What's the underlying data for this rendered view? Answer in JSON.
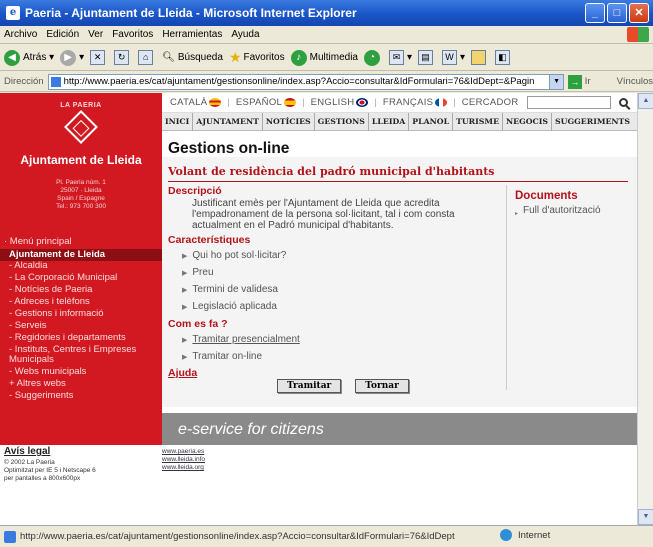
{
  "window": {
    "title": "Paeria - Ajuntament de Lleida - Microsoft Internet Explorer"
  },
  "menubar": [
    "Archivo",
    "Edición",
    "Ver",
    "Favoritos",
    "Herramientas",
    "Ayuda"
  ],
  "toolbar": {
    "back": "Atrás",
    "search": "Búsqueda",
    "favorites": "Favoritos",
    "multimedia": "Multimedia"
  },
  "address": {
    "label": "Dirección",
    "url": "http://www.paeria.es/cat/ajuntament/gestionsonline/index.asp?Accio=consultar&IdFormulari=76&IdDept=&Pagin",
    "go": "Ir",
    "links": "Vínculos"
  },
  "left": {
    "paeria": "LA PAERIA",
    "title": "Ajuntament de Lleida",
    "address_lines": [
      "Pl. Paeria núm. 1",
      "25007 · Lleida",
      "Spain / Espagne",
      "Tel.: 973 700 300"
    ],
    "menu_principal": "· Menú principal",
    "section": "Ajuntament de Lleida",
    "items": [
      "- Alcaldia",
      "- La Corporació Municipal",
      "- Notícies de Paeria",
      "- Adreces i telèfons",
      "- Gestions i informació",
      "- Serveis",
      "- Regidories i departaments",
      "- Instituts, Centres i Empreses Municipals",
      "- Webs municipals",
      "+ Altres webs",
      "- Suggeriments"
    ]
  },
  "langbar": {
    "ca": "CATALÀ",
    "es": "ESPAÑOL",
    "en": "ENGLISH",
    "fr": "FRANÇAIS",
    "search_label": "CERCADOR"
  },
  "topnav": [
    "INICI",
    "AJUNTAMENT",
    "NOTÍCIES",
    "GESTIONS",
    "LLEIDA",
    "PLANOL",
    "TURISME",
    "NEGOCIS",
    "SUGGERIMENTS"
  ],
  "page": {
    "title": "Gestions on-line",
    "form_title": "Volant de residència del padró municipal d'habitants",
    "descripcio_h": "Descripció",
    "descripcio": "Justificant emès per l'Ajuntament de Lleida que acredita l'empadronament de la persona sol·licitant, tal i com consta actualment en el Padró municipal d'habitants.",
    "caract_h": "Característiques",
    "caract_links": [
      "Qui ho pot sol·licitar?",
      "Preu",
      "Termini de validesa",
      "Legislació aplicada"
    ],
    "comes_h": "Com es fa ?",
    "comes_links": [
      "Tramitar presencialment",
      "Tramitar on-line"
    ],
    "ajuda": "Ajuda",
    "btn_tramitar": "Tramitar",
    "btn_tornar": "Tornar",
    "docs_h": "Documents",
    "docs_link": "Full d'autorització",
    "eservice": "e-service for citizens"
  },
  "footer": {
    "avis": "Avís legal",
    "copy": [
      "© 2002 La Paeria",
      "Optimitzat per IE 5 i Netscape 6",
      "per pantalles a 800x600px"
    ],
    "urls": [
      "www.paeria.es",
      "www.lleida.info",
      "www.lleida.org"
    ]
  },
  "status": {
    "url": "http://www.paeria.es/cat/ajuntament/gestionsonline/index.asp?Accio=consultar&IdFormulari=76&IdDept",
    "zone": "Internet"
  },
  "colors": {
    "brand_red": "#d21922",
    "title_blue": "#1a55c8"
  }
}
